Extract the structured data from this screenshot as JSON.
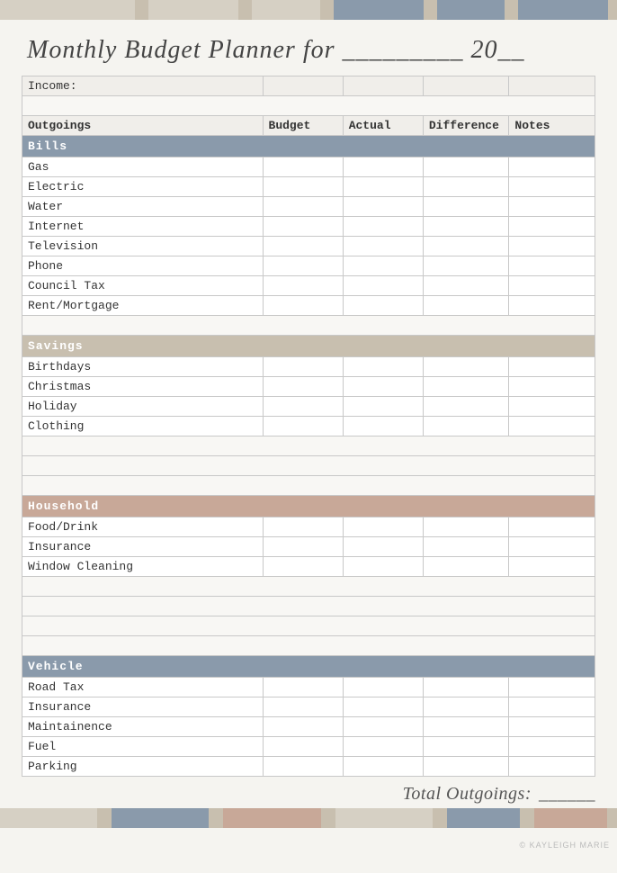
{
  "topBar": {
    "segments": [
      {
        "color": "#d6d0c4",
        "flex": 3
      },
      {
        "color": "#c8bfaf",
        "flex": 0.3
      },
      {
        "color": "#d6d0c4",
        "flex": 2
      },
      {
        "color": "#c8bfaf",
        "flex": 0.3
      },
      {
        "color": "#d6d0c4",
        "flex": 1.5
      },
      {
        "color": "#c8bfaf",
        "flex": 0.3
      },
      {
        "color": "#8a9aab",
        "flex": 2
      },
      {
        "color": "#c8bfaf",
        "flex": 0.3
      },
      {
        "color": "#8a9aab",
        "flex": 1.5
      },
      {
        "color": "#c8bfaf",
        "flex": 0.3
      },
      {
        "color": "#8a9aab",
        "flex": 2
      },
      {
        "color": "#c8bfaf",
        "flex": 0.2
      }
    ]
  },
  "title": "Monthly Budget Planner for _________ 20__",
  "income": {
    "label": "Income:"
  },
  "tableHeaders": {
    "outgoings": "Outgoings",
    "budget": "Budget",
    "actual": "Actual",
    "difference": "Difference",
    "notes": "Notes"
  },
  "categories": {
    "bills": {
      "label": "Bills",
      "items": [
        "Gas",
        "Electric",
        "Water",
        "Internet",
        "Television",
        "Phone",
        "Council Tax",
        "Rent/Mortgage"
      ]
    },
    "savings": {
      "label": "Savings",
      "items": [
        "Birthdays",
        "Christmas",
        "Holiday",
        "Clothing"
      ]
    },
    "household": {
      "label": "Household",
      "items": [
        "Food/Drink",
        "Insurance",
        "Window Cleaning"
      ]
    },
    "vehicle": {
      "label": "Vehicle",
      "items": [
        "Road Tax",
        "Insurance",
        "Maintainence",
        "Fuel",
        "Parking"
      ]
    }
  },
  "emptyRows": {
    "afterBills": 1,
    "afterSavings": 3,
    "afterHousehold": 4,
    "afterVehicle": 0
  },
  "total": {
    "label": "Total Outgoings:",
    "value": "______"
  },
  "watermark": "© Kayleigh Marie",
  "bottomBar": {
    "segments": [
      {
        "color": "#d6d0c4",
        "flex": 2
      },
      {
        "color": "#c8bfaf",
        "flex": 0.3
      },
      {
        "color": "#8a9aab",
        "flex": 2
      },
      {
        "color": "#c8bfaf",
        "flex": 0.3
      },
      {
        "color": "#c8a898",
        "flex": 2
      },
      {
        "color": "#c8bfaf",
        "flex": 0.3
      },
      {
        "color": "#d6d0c4",
        "flex": 2
      },
      {
        "color": "#c8bfaf",
        "flex": 0.3
      },
      {
        "color": "#8a9aab",
        "flex": 1.5
      },
      {
        "color": "#c8bfaf",
        "flex": 0.3
      },
      {
        "color": "#c8a898",
        "flex": 1.5
      },
      {
        "color": "#c8bfaf",
        "flex": 0.2
      }
    ]
  }
}
